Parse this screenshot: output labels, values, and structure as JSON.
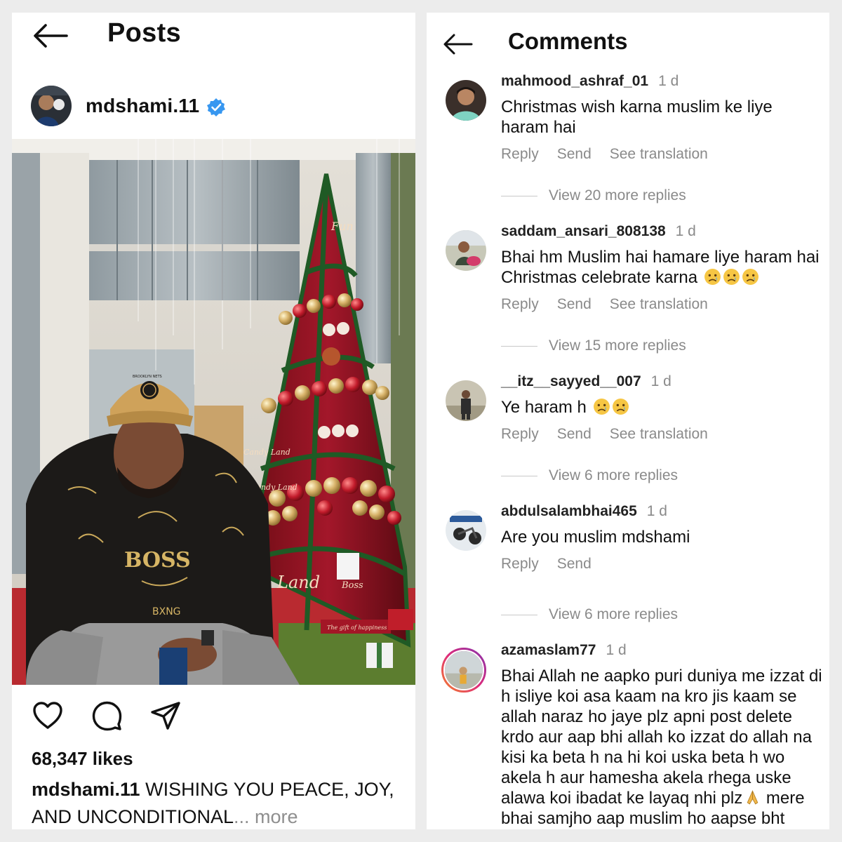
{
  "posts": {
    "title": "Posts",
    "back_icon": "arrow-left-icon",
    "author": "mdshami.11",
    "verified_icon": "verified-badge-icon",
    "likes": "68,347 likes",
    "caption_user": "mdshami.11",
    "caption_text": " WISHING YOU PEACE, JOY, AND UNCONDITIONAL",
    "caption_more": "... more",
    "action_icons": [
      "heart-icon",
      "comment-icon",
      "share-icon"
    ],
    "image_text": {
      "cap": "BROOKLYN NETS",
      "hoodie_brand": "BOSS",
      "hoodie_sub": "BXNG",
      "tree_words": [
        "Fun",
        "Land",
        "Candy Land",
        "Land",
        "Boss",
        "Candy Land",
        "The gift of happiness"
      ]
    }
  },
  "comments": {
    "title": "Comments",
    "back_icon": "arrow-left-icon",
    "items": [
      {
        "user": "mahmood_ashraf_01",
        "time": "1 d",
        "text": "Christmas wish karna muslim ke liye haram hai",
        "reply": "Reply",
        "send": "Send",
        "translate": "See translation",
        "view_more": "View 20 more replies"
      },
      {
        "user": "saddam_ansari_808138",
        "time": "1 d",
        "text": "Bhai hm Muslim hai hamare liye haram hai Christmas celebrate karna",
        "emoji": [
          "sad-face-icon",
          "sad-face-icon",
          "sad-face-icon"
        ],
        "reply": "Reply",
        "send": "Send",
        "translate": "See translation",
        "view_more": "View 15 more replies"
      },
      {
        "user": "__itz__sayyed__007",
        "time": "1 d",
        "text": "Ye haram h",
        "emoji": [
          "sad-face-icon",
          "sad-face-icon"
        ],
        "reply": "Reply",
        "send": "Send",
        "translate": "See translation",
        "view_more": "View 6 more replies"
      },
      {
        "user": "abdulsalambhai465",
        "time": "1 d",
        "text": "Are you muslim mdshami",
        "reply": "Reply",
        "send": "Send",
        "view_more": "View 6 more replies"
      },
      {
        "user": "azamaslam77",
        "time": "1 d",
        "text_a": "Bhai Allah ne aapko puri duniya me izzat di h isliye koi asa kaam na kro jis kaam se allah naraz ho jaye plz apni post delete krdo aur aap bhi allah ko izzat do allah na kisi ka beta  h na hi koi uska beta h wo akela h aur hamesha akela rhega  uske alawa koi ibadat ke layaq nhi plz",
        "emoji": [
          "folded-hands-icon"
        ],
        "text_b": " mere bhai samjho aap muslim ho aapse bht"
      }
    ]
  },
  "colors": {
    "verified_blue": "#3797f0",
    "muted_gray": "#8a8a8a",
    "story_ring_a": "#f58529",
    "story_ring_b": "#dd2a7b"
  }
}
